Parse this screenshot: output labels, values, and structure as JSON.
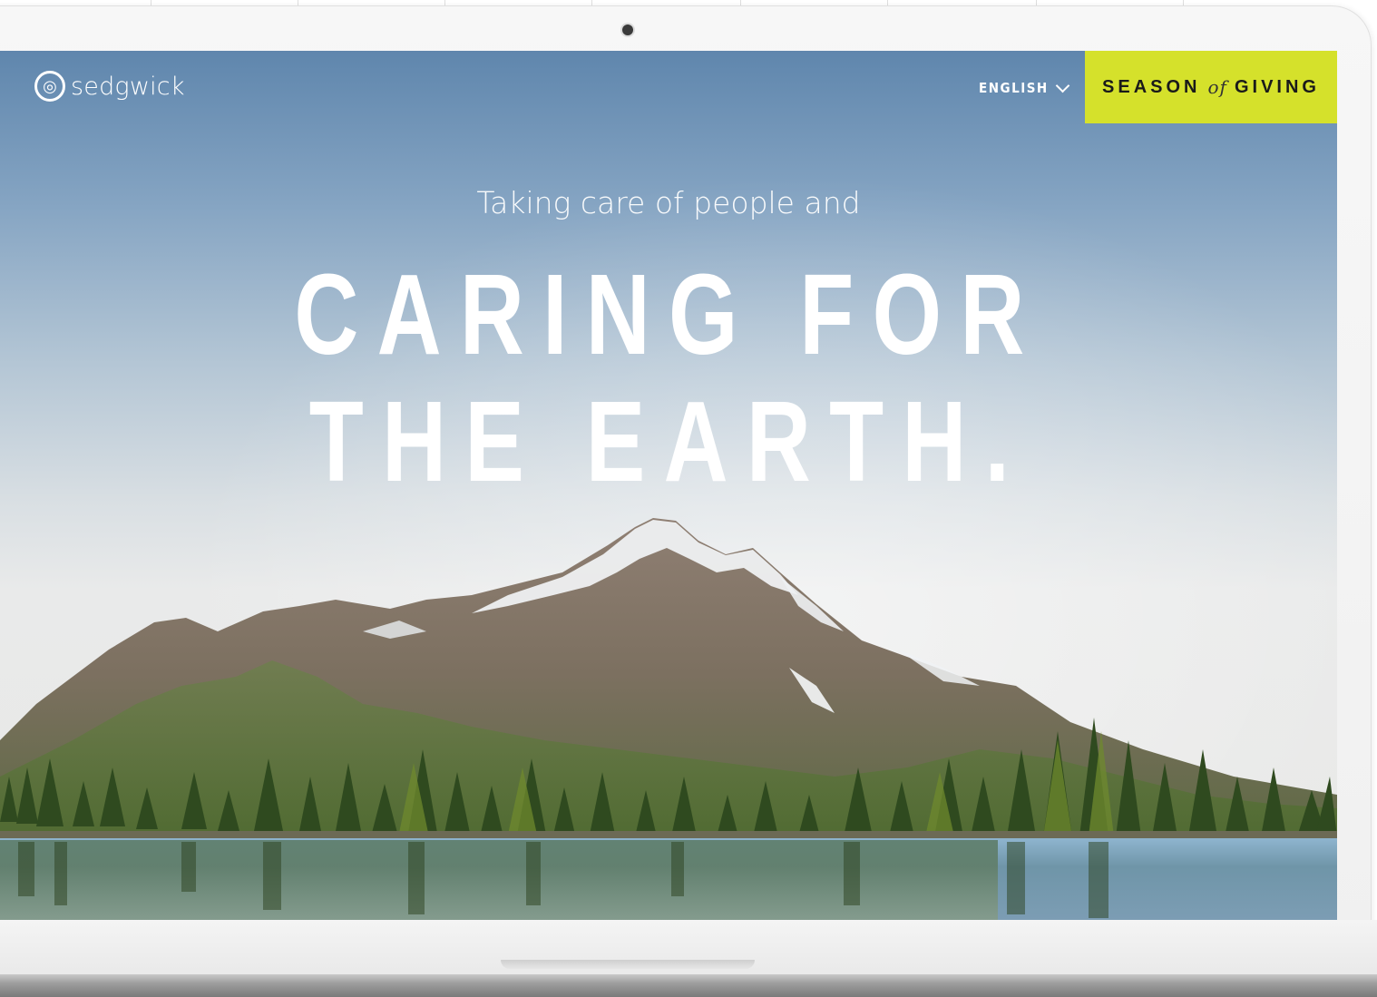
{
  "brand": {
    "name": "sedgwick"
  },
  "header": {
    "language": "ENGLISH",
    "cta": {
      "part1": "SEASON",
      "part2": "of",
      "part3": "GIVING",
      "color": "#d5e12b"
    }
  },
  "hero": {
    "kicker": "Taking care of people and",
    "headline_line1": "CARING FOR",
    "headline_line2": "THE EARTH."
  },
  "icons": {
    "logo": "globe-logo-icon",
    "language": "chevron-down-icon",
    "camera": "camera-dot"
  }
}
